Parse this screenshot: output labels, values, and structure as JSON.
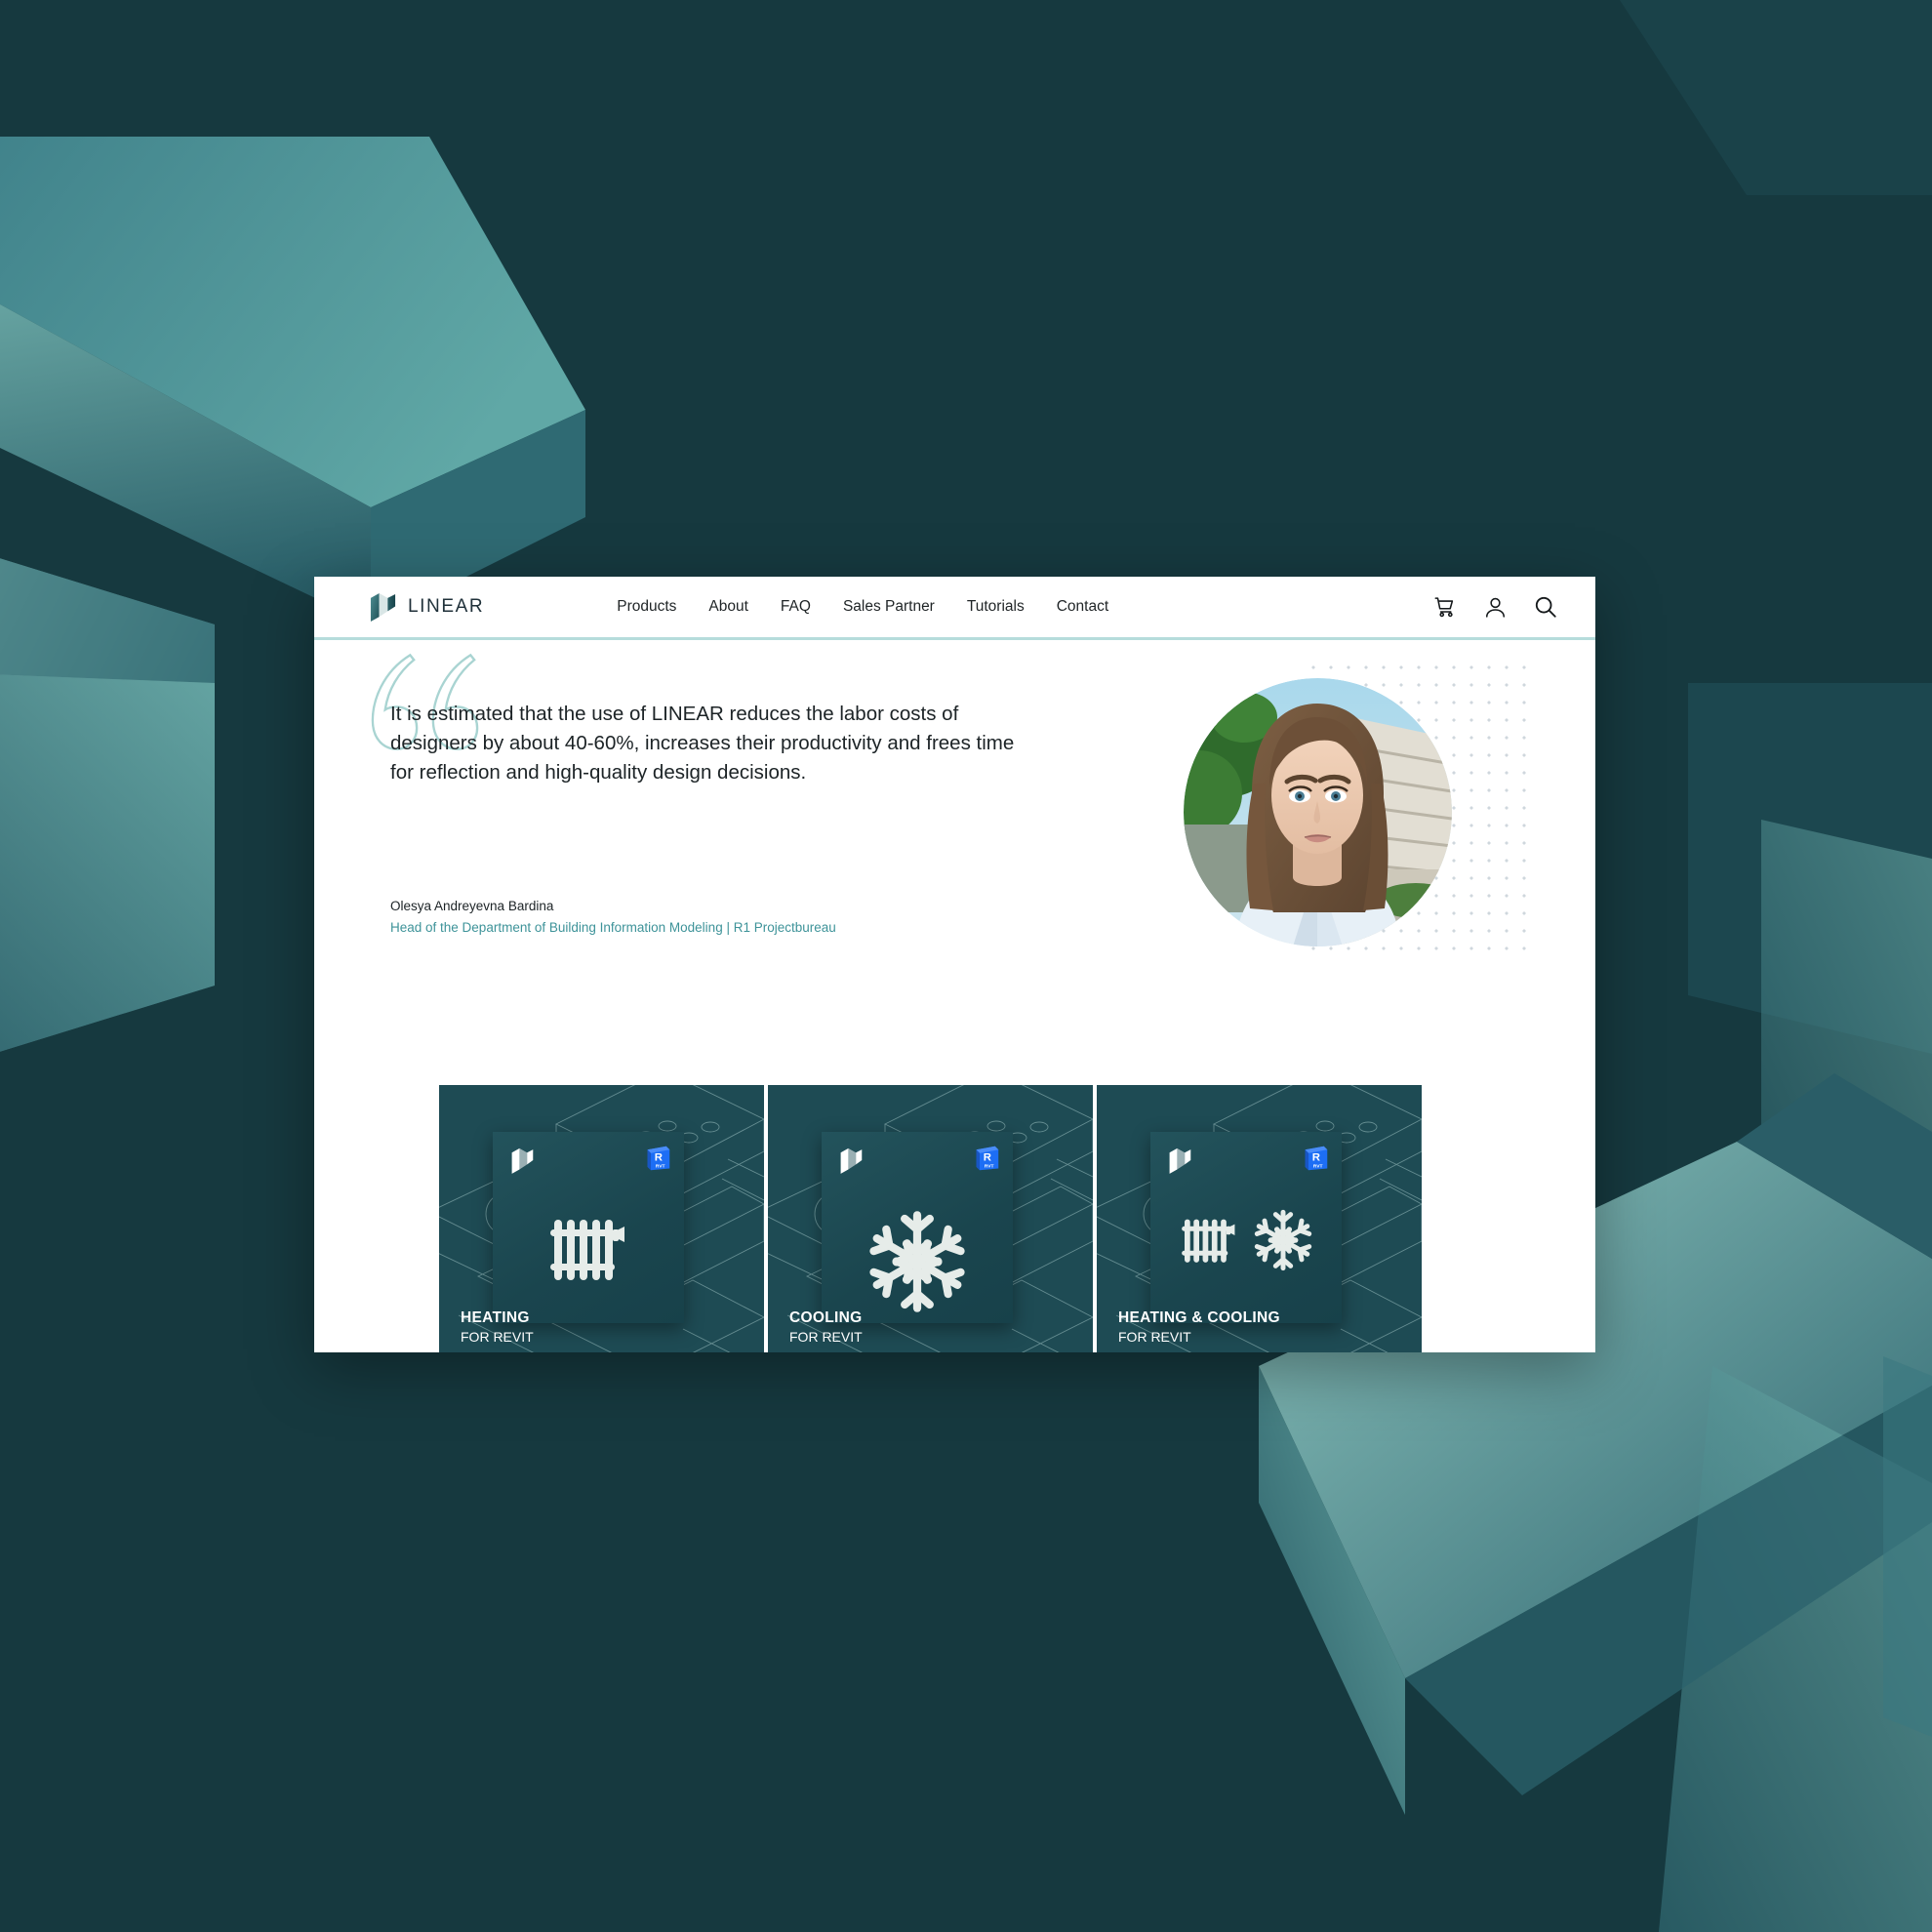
{
  "site": {
    "brand_name": "LINEAR",
    "logo_icon": "linear-cube-logo",
    "accent_color": "#3e9399",
    "background_color": "#16393f",
    "panel_color": "#ffffff",
    "rule_color": "#b6dcdb"
  },
  "nav": {
    "items": [
      {
        "label": "Products"
      },
      {
        "label": "About"
      },
      {
        "label": "FAQ"
      },
      {
        "label": "Sales Partner"
      },
      {
        "label": "Tutorials"
      },
      {
        "label": "Contact"
      }
    ],
    "icons": [
      {
        "name": "shopping-cart-icon"
      },
      {
        "name": "user-account-icon"
      },
      {
        "name": "search-icon"
      }
    ]
  },
  "testimonial": {
    "quote_mark_icon": "double-quote-icon",
    "quote": "It is estimated that the use of LINEAR reduces the labor costs of designers by about 40-60%, increases their productivity and frees time for reflection and high-quality design decisions.",
    "author_name": "Olesya Andreyevna Bardina",
    "author_role": "Head of the Department of Building Information Modeling | R1 Projectbureau",
    "portrait_alt": "portrait-photo"
  },
  "products": {
    "badge_letter": "R",
    "badge_sub": "RVT",
    "badge_color": "#1d6ef5",
    "cards": [
      {
        "title": "HEATING",
        "subtitle": "FOR REVIT",
        "icons": [
          "radiator-icon"
        ]
      },
      {
        "title": "COOLING",
        "subtitle": "FOR REVIT",
        "icons": [
          "snowflake-icon"
        ]
      },
      {
        "title": "HEATING & COOLING",
        "subtitle": "FOR REVIT",
        "icons": [
          "radiator-icon",
          "snowflake-icon"
        ]
      }
    ]
  }
}
